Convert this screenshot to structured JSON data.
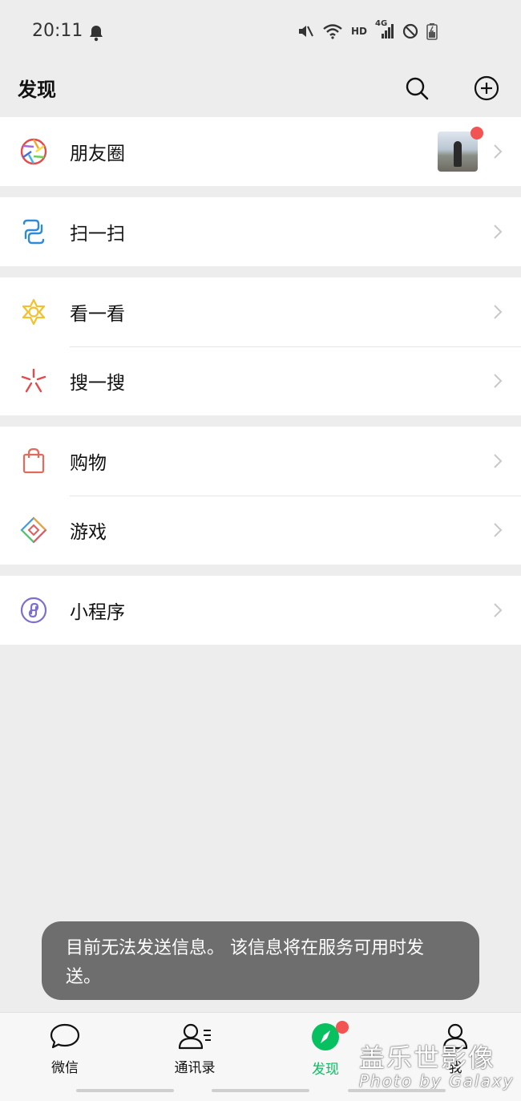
{
  "status_bar": {
    "time": "20:11",
    "network": "HD",
    "network_gen": "4G"
  },
  "header": {
    "title": "发现"
  },
  "menu": {
    "moments": {
      "label": "朋友圈"
    },
    "scan": {
      "label": "扫一扫"
    },
    "top_stories": {
      "label": "看一看"
    },
    "search": {
      "label": "搜一搜"
    },
    "shopping": {
      "label": "购物"
    },
    "games": {
      "label": "游戏"
    },
    "mini_programs": {
      "label": "小程序"
    }
  },
  "toast": {
    "text": "目前无法发送信息。 该信息将在服务可用时发送。"
  },
  "tabbar": {
    "chats": "微信",
    "contacts": "通讯录",
    "discover": "发现",
    "me": "我"
  },
  "watermark": {
    "cn": "盖乐世影像",
    "en": "Photo by Galaxy"
  },
  "colors": {
    "accent": "#07c160",
    "badge": "#f25353",
    "background": "#ededed",
    "toast": "#6e6e6e"
  }
}
